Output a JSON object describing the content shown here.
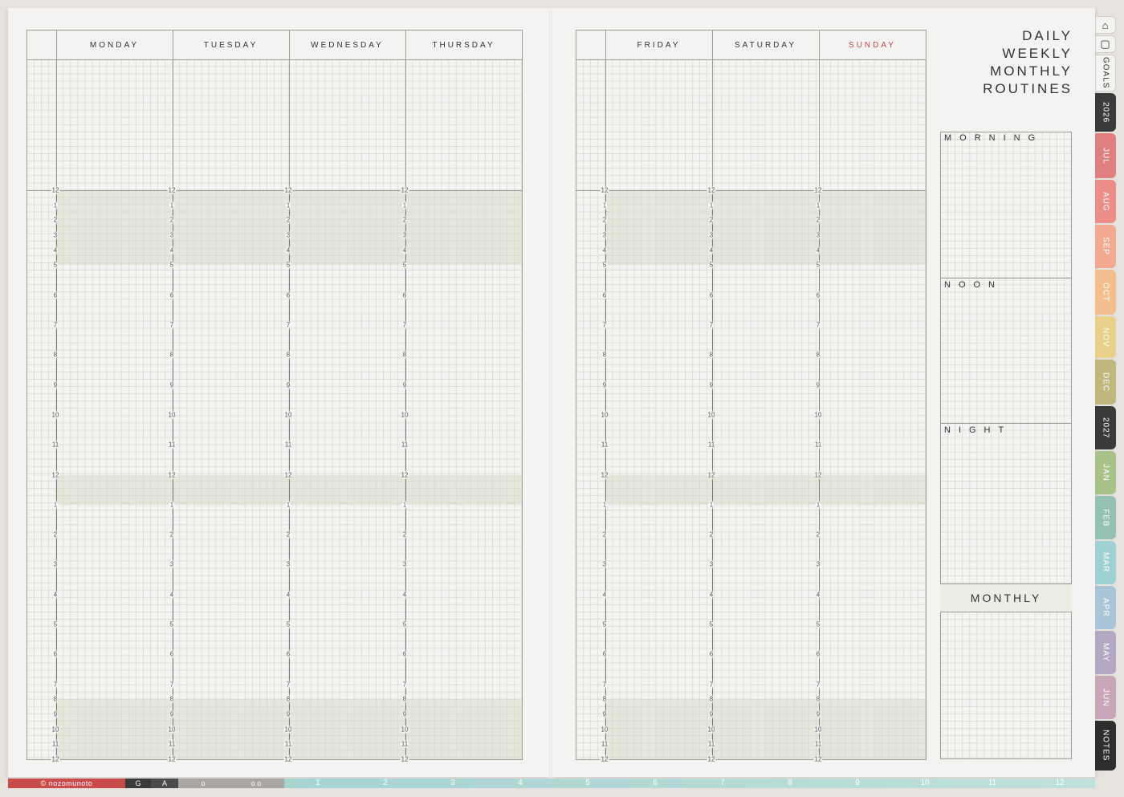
{
  "left_days": [
    "MONDAY",
    "TUESDAY",
    "WEDNESDAY",
    "THURSDAY"
  ],
  "right_days": [
    "FRIDAY",
    "SATURDAY",
    "SUNDAY"
  ],
  "hour_labels": [
    "12",
    "1",
    "2",
    "3",
    "4",
    "5",
    "6",
    "7",
    "8",
    "9",
    "10",
    "11",
    "12",
    "1",
    "2",
    "3",
    "4",
    "5",
    "6",
    "7",
    "8",
    "9",
    "10",
    "11",
    "12"
  ],
  "title_lines": [
    "DAILY",
    "WEEKLY",
    "MONTHLY",
    "ROUTINES"
  ],
  "routines": [
    "MORNING",
    "NOON",
    "NIGHT"
  ],
  "monthly_label": "MONTHLY",
  "colors": {
    "sunday": "#c24a4a",
    "grid": "#dcdcd8",
    "band": "#d6d8c4"
  },
  "side_tabs": [
    {
      "label": "home-icon",
      "type": "icon",
      "color": "#f4f3f1"
    },
    {
      "label": "square-icon",
      "type": "icon",
      "color": "#f4f3f1"
    },
    {
      "label": "GOALS",
      "type": "text",
      "color": "#f4f3f1",
      "text_color": "#333"
    },
    {
      "label": "2026",
      "type": "text",
      "color": "#3a3a3a"
    },
    {
      "label": "JUL",
      "type": "text",
      "color": "#e07f7f"
    },
    {
      "label": "AUG",
      "type": "text",
      "color": "#ec8d88"
    },
    {
      "label": "SEP",
      "type": "text",
      "color": "#f2a98f"
    },
    {
      "label": "OCT",
      "type": "text",
      "color": "#f3bf8f"
    },
    {
      "label": "NOV",
      "type": "text",
      "color": "#e8cf8a"
    },
    {
      "label": "DEC",
      "type": "text",
      "color": "#bfb77e"
    },
    {
      "label": "2027",
      "type": "text",
      "color": "#3a3a3a"
    },
    {
      "label": "JAN",
      "type": "text",
      "color": "#a8c289"
    },
    {
      "label": "FEB",
      "type": "text",
      "color": "#95c0b4"
    },
    {
      "label": "MAR",
      "type": "text",
      "color": "#9fd1d3"
    },
    {
      "label": "APR",
      "type": "text",
      "color": "#a9c4d6"
    },
    {
      "label": "MAY",
      "type": "text",
      "color": "#b3a7c1"
    },
    {
      "label": "JUN",
      "type": "text",
      "color": "#c7a6b8"
    },
    {
      "label": "NOTES",
      "type": "text",
      "color": "#2e2e2e"
    }
  ],
  "bottom_bar": {
    "brand": "© nozomunoto",
    "brand_color": "#c94a4a",
    "G": "G",
    "A": "A",
    "o1": "o",
    "oo": "o o",
    "months": [
      "1",
      "2",
      "3",
      "4",
      "5",
      "6",
      "7",
      "8",
      "9",
      "10",
      "11",
      "12"
    ]
  }
}
